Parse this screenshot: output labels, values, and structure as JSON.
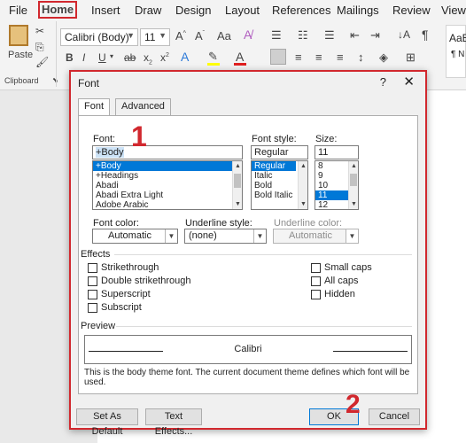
{
  "ribbon": {
    "tabs": [
      "File",
      "Home",
      "Insert",
      "Draw",
      "Design",
      "Layout",
      "References",
      "Mailings",
      "Review",
      "View"
    ],
    "font_name": "Calibri (Body)",
    "font_size": "11",
    "paste_label": "Paste",
    "clipboard_label": "Clipboard",
    "style_sample": "AaB",
    "style_name": "¶ N"
  },
  "dialog": {
    "title": "Font",
    "help": "?",
    "tabs": {
      "font": "Font",
      "advanced": "Advanced"
    },
    "font_label": "Font:",
    "font_value": "+Body",
    "font_list": [
      "+Body",
      "+Headings",
      "Abadi",
      "Abadi Extra Light",
      "Adobe Arabic"
    ],
    "font_style_label": "Font style:",
    "font_style_value": "Regular",
    "style_list": [
      "Regular",
      "Italic",
      "Bold",
      "Bold Italic"
    ],
    "size_label": "Size:",
    "size_value": "11",
    "size_list": [
      "8",
      "9",
      "10",
      "11",
      "12"
    ],
    "font_color_label": "Font color:",
    "font_color_value": "Automatic",
    "underline_style_label": "Underline style:",
    "underline_style_value": "(none)",
    "underline_color_label": "Underline color:",
    "underline_color_value": "Automatic",
    "effects_label": "Effects",
    "effects_left": [
      "Strikethrough",
      "Double strikethrough",
      "Superscript",
      "Subscript"
    ],
    "effects_right": [
      "Small caps",
      "All caps",
      "Hidden"
    ],
    "preview_label": "Preview",
    "preview_text": "Calibri",
    "theme_note": "This is the body theme font. The current document theme defines which font will be used.",
    "buttons": {
      "set_default": "Set As Default",
      "text_effects": "Text Effects...",
      "ok": "OK",
      "cancel": "Cancel"
    }
  },
  "annotations": {
    "one": "1",
    "two": "2"
  },
  "colors": {
    "accent": "#0078d7",
    "highlight_red": "#d1282e"
  }
}
